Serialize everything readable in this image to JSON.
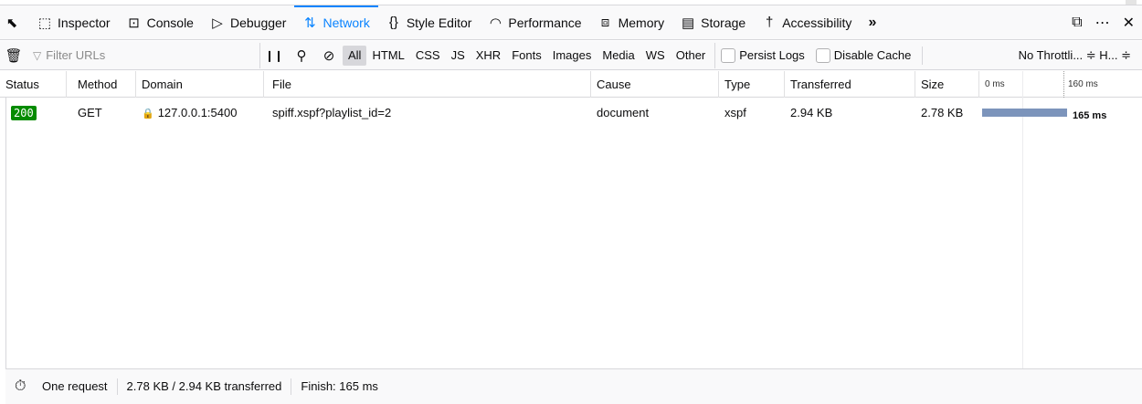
{
  "tabs": [
    {
      "label": "Inspector",
      "icon": "inspector-icon",
      "glyph": "⬚"
    },
    {
      "label": "Console",
      "icon": "console-icon",
      "glyph": "⊡"
    },
    {
      "label": "Debugger",
      "icon": "debugger-icon",
      "glyph": "▷"
    },
    {
      "label": "Network",
      "icon": "network-icon",
      "glyph": "⇅"
    },
    {
      "label": "Style Editor",
      "icon": "style-editor-icon",
      "glyph": "{}"
    },
    {
      "label": "Performance",
      "icon": "performance-icon",
      "glyph": "◠"
    },
    {
      "label": "Memory",
      "icon": "memory-icon",
      "glyph": "⧈"
    },
    {
      "label": "Storage",
      "icon": "storage-icon",
      "glyph": "▤"
    },
    {
      "label": "Accessibility",
      "icon": "accessibility-icon",
      "glyph": "†"
    }
  ],
  "selected_tab": "Network",
  "toolbar": {
    "filter_placeholder": "Filter URLs",
    "type_filters": [
      "All",
      "HTML",
      "CSS",
      "JS",
      "XHR",
      "Fonts",
      "Images",
      "Media",
      "WS",
      "Other"
    ],
    "persist_logs": "Persist Logs",
    "disable_cache": "Disable Cache",
    "throttling": "No Throttli... ≑ H... ≑"
  },
  "columns": {
    "status": "Status",
    "method": "Method",
    "domain": "Domain",
    "file": "File",
    "cause": "Cause",
    "type": "Type",
    "transferred": "Transferred",
    "size": "Size",
    "wf_start": "0 ms",
    "wf_mark": "160 ms"
  },
  "requests": [
    {
      "status": "200",
      "method": "GET",
      "domain": "127.0.0.1:5400",
      "file": "spiff.xspf?playlist_id=2",
      "cause": "document",
      "type": "xspf",
      "transferred": "2.94 KB",
      "size": "2.78 KB",
      "timing": "165 ms"
    }
  ],
  "statusbar": {
    "requests": "One request",
    "sizes": "2.78 KB / 2.94 KB transferred",
    "finish": "Finish: 165 ms"
  },
  "colors": {
    "accent": "#0a84ff",
    "status_ok": "#058b00",
    "waterfall": "#7c94bb"
  }
}
